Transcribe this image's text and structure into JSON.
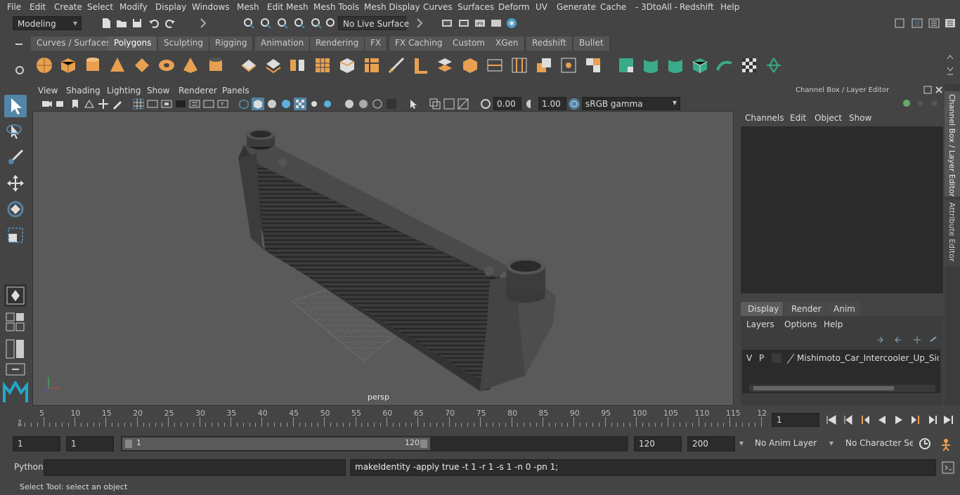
{
  "menu": [
    "File",
    "Edit",
    "Create",
    "Select",
    "Modify",
    "Display",
    "Windows",
    "Mesh",
    "Edit Mesh",
    "Mesh Tools",
    "Mesh Display",
    "Curves",
    "Surfaces",
    "Deform",
    "UV",
    "Generate",
    "Cache",
    "- 3DtoAll -",
    "Redshift",
    "Help"
  ],
  "status": {
    "mode": "Modeling",
    "live_surface": "No Live Surface"
  },
  "shelf_tabs": [
    "Curves / Surfaces",
    "Polygons",
    "Sculpting",
    "Rigging",
    "Animation",
    "Rendering",
    "FX",
    "FX Caching",
    "Custom",
    "XGen",
    "Redshift",
    "Bullet"
  ],
  "shelf_active": "Polygons",
  "viewport": {
    "menu": [
      "View",
      "Shading",
      "Lighting",
      "Show",
      "Renderer",
      "Panels"
    ],
    "exposure": "0.00",
    "gamma": "1.00",
    "color_space": "sRGB gamma",
    "camera_label": "persp"
  },
  "channel_box": {
    "title": "Channel Box / Layer Editor",
    "menu": [
      "Channels",
      "Edit",
      "Object",
      "Show"
    ]
  },
  "layer_editor": {
    "tabs": [
      "Display",
      "Render",
      "Anim"
    ],
    "active_tab": "Display",
    "menu": [
      "Layers",
      "Options",
      "Help"
    ],
    "layer": {
      "v": "V",
      "p": "P",
      "name": "Mishimoto_Car_Intercooler_Up_Side_Pipe"
    }
  },
  "side_tabs": [
    "Channel Box / Layer Editor",
    "Attribute Editor"
  ],
  "timeline": {
    "ticks": [
      "5",
      "10",
      "15",
      "20",
      "25",
      "30",
      "35",
      "40",
      "45",
      "50",
      "55",
      "60",
      "65",
      "70",
      "75",
      "80",
      "85",
      "90",
      "95",
      "100",
      "105",
      "110",
      "115",
      "12"
    ],
    "start_marker": "1",
    "current_frame": "1"
  },
  "range": {
    "start": "1",
    "anim_start": "1",
    "slider_start": "1",
    "slider_end": "120",
    "end": "120",
    "anim_end": "200",
    "anim_layer": "No Anim Layer",
    "character_set": "No Character Set"
  },
  "command": {
    "label": "Python",
    "result": "makeIdentity -apply true -t 1 -r 1 -s 1 -n 0 -pn 1;"
  },
  "help_line": "Select Tool: select an object",
  "colors": {
    "accent": "#5285a6",
    "shelf_orange": "#e8a050",
    "shelf_teal": "#3aaa8a",
    "bg": "#444444"
  }
}
